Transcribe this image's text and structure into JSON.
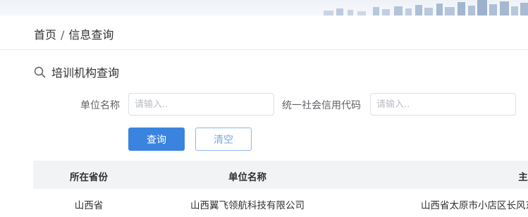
{
  "breadcrumb": {
    "home": "首页",
    "separator": "/",
    "current": "信息查询"
  },
  "section": {
    "title": "培训机构查询",
    "icon": "search-icon"
  },
  "search_form": {
    "unit_name_label": "单位名称",
    "unit_name_placeholder": "请输入..",
    "credit_code_label": "统一社会信用代码",
    "credit_code_placeholder": "请输入..",
    "query_button": "查询",
    "clear_button": "清空"
  },
  "table": {
    "columns": [
      "所在省份",
      "单位名称",
      "主"
    ],
    "rows": [
      [
        "山西省",
        "山西翼飞领航科技有限公司",
        "山西省太原市小店区长风东"
      ]
    ]
  },
  "colors": {
    "primary": "#3a84e0",
    "header_bg": "#f2f3f5",
    "border": "#dcdfe6"
  }
}
